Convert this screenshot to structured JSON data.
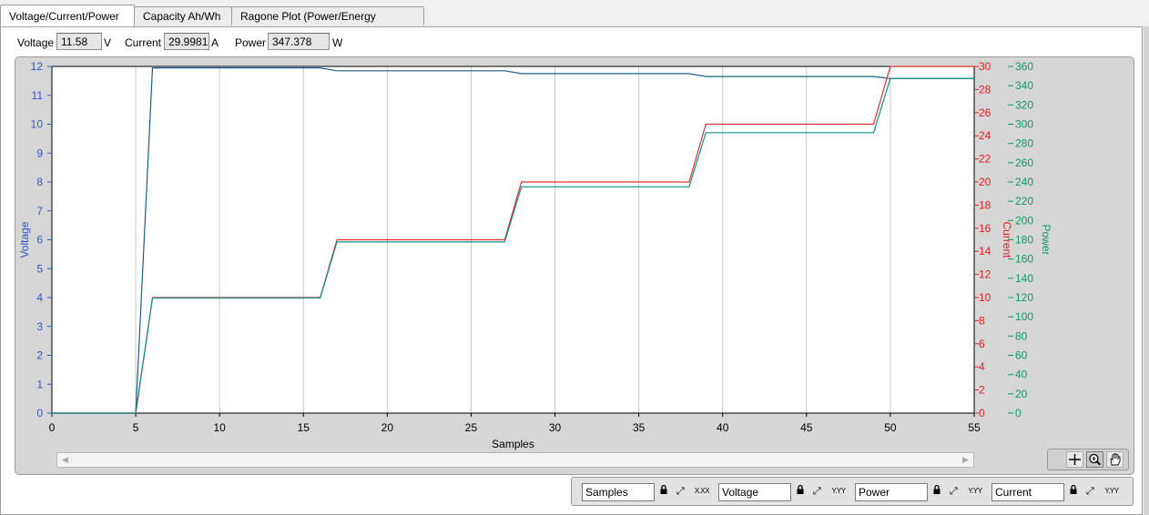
{
  "tabs": [
    {
      "label": "Voltage/Current/Power",
      "active": true
    },
    {
      "label": "Capacity Ah/Wh",
      "active": false
    },
    {
      "label": "Ragone Plot (Power/Energy Density)",
      "active": false
    }
  ],
  "readouts": {
    "voltage": {
      "label": "Voltage",
      "value": "11.58",
      "unit": "V"
    },
    "current": {
      "label": "Current",
      "value": "29.9981",
      "unit": "A"
    },
    "power": {
      "label": "Power",
      "value": "347.378",
      "unit": "W"
    }
  },
  "chart_data": {
    "type": "line",
    "xlabel": "Samples",
    "xlim": [
      0,
      55
    ],
    "x_ticks": [
      0,
      5,
      10,
      15,
      20,
      25,
      30,
      35,
      40,
      45,
      50,
      55
    ],
    "axes": {
      "voltage": {
        "label": "Voltage",
        "lim": [
          0,
          12
        ],
        "ticks": [
          0,
          1,
          2,
          3,
          4,
          5,
          6,
          7,
          8,
          9,
          10,
          11,
          12
        ],
        "color": "#3355cc"
      },
      "current": {
        "label": "Current",
        "lim": [
          0,
          30
        ],
        "ticks": [
          0,
          2,
          4,
          6,
          8,
          10,
          12,
          14,
          16,
          18,
          20,
          22,
          24,
          26,
          28,
          30
        ],
        "color": "#dd2222"
      },
      "power": {
        "label": "Power",
        "lim": [
          0,
          360
        ],
        "ticks": [
          0,
          20,
          40,
          60,
          80,
          100,
          120,
          140,
          160,
          180,
          200,
          220,
          240,
          260,
          280,
          300,
          320,
          340,
          360
        ],
        "color": "#119966"
      }
    },
    "grid": true,
    "series": [
      {
        "axis": "voltage",
        "color": "#1a5e8a",
        "x": [
          0,
          5,
          6,
          16,
          17,
          27,
          28,
          38,
          39,
          49,
          50,
          55
        ],
        "y": [
          0,
          0,
          11.95,
          11.95,
          11.85,
          11.85,
          11.75,
          11.75,
          11.65,
          11.65,
          11.58,
          11.58
        ]
      },
      {
        "axis": "current",
        "color": "#e03030",
        "x": [
          0,
          5,
          6,
          16,
          17,
          27,
          28,
          38,
          39,
          49,
          50,
          55
        ],
        "y": [
          0,
          0,
          10,
          10,
          15,
          15,
          20,
          20,
          25,
          25,
          30,
          30
        ]
      },
      {
        "axis": "power",
        "color": "#138f8a",
        "x": [
          0,
          5,
          6,
          16,
          17,
          27,
          28,
          38,
          39,
          49,
          50,
          55
        ],
        "y": [
          0,
          0,
          119.5,
          119.5,
          177.7,
          177.7,
          235,
          235,
          291.2,
          291.2,
          347.4,
          347.4
        ]
      }
    ]
  },
  "legend_axes": [
    {
      "name": "Samples"
    },
    {
      "name": "Voltage"
    },
    {
      "name": "Power"
    },
    {
      "name": "Current"
    }
  ],
  "scale_labels": {
    "x": "X.XX",
    "y": "Y.YY"
  },
  "icons": {
    "lock": "lock-icon",
    "cursor_tool": "crosshair-icon",
    "zoom_tool": "zoom-icon",
    "pan_tool": "hand-icon"
  }
}
